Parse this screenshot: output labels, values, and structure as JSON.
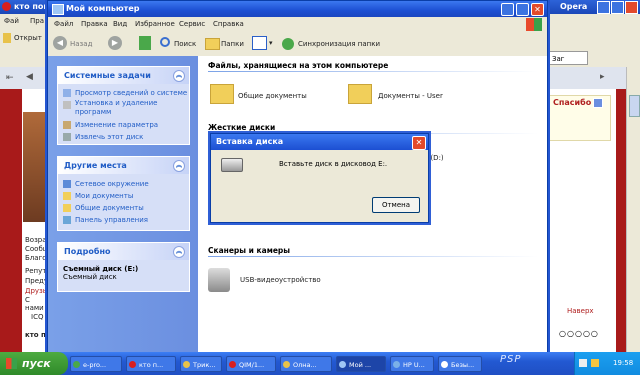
{
  "background_browser": {
    "tab_title": "кто пом",
    "browser_name": "Opera",
    "menu_prefix": "Фай",
    "menu_prefix2": "Пра",
    "toolbar_open": "Открыт",
    "right_tab": "Заг",
    "thanks": "Спасибо",
    "top_link": "Наверх",
    "bottom_label": "кто п",
    "left_texts": [
      "Возра",
      "Сообщ",
      "Благо",
      "Репут",
      "Преду",
      "Друзь",
      "С нами",
      "ICQ"
    ]
  },
  "window": {
    "title": "Мой компьютер",
    "menu": [
      "Файл",
      "Правка",
      "Вид",
      "Избранное",
      "Сервис",
      "Справка"
    ],
    "toolbar": {
      "back": "Назад",
      "search": "Поиск",
      "folders": "Папки",
      "sync": "Синхронизация папки"
    }
  },
  "left_panel": {
    "system_tasks": {
      "title": "Системные задачи",
      "items": [
        "Просмотр сведений о системе",
        "Установка и удаление программ",
        "Изменение параметра",
        "Извлечь этот диск"
      ]
    },
    "other_places": {
      "title": "Другие места",
      "items": [
        "Сетевое окружение",
        "Мои документы",
        "Общие документы",
        "Панель управления"
      ]
    },
    "details": {
      "title": "Подробно",
      "name": "Съемный диск (E:)",
      "type": "Съемный диск"
    }
  },
  "content": {
    "section_files": "Файлы, хранящиеся на этом компьютере",
    "shared_docs": "Общие документы",
    "user_docs": "Документы - User",
    "section_hdd": "Жесткие диски",
    "drive_d_suffix": "к (D:)",
    "section_scanners": "Сканеры и камеры",
    "usb_video": "USB-видеоустройство"
  },
  "dialog": {
    "title": "Вставка диска",
    "message": "Вставьте диск в дисковод E:.",
    "cancel": "Отмена"
  },
  "taskbar": {
    "start": "пуск",
    "tasks": [
      "e-pro...",
      "кто п...",
      "Трик...",
      "QIM/1...",
      "Олна...",
      "Мой ...",
      "HP U...",
      "Безы..."
    ],
    "clock": "19:58"
  },
  "colors": {
    "xp_blue": "#1c4fd2",
    "panel_link": "#215dc6",
    "dialog_close": "#e24a2b",
    "start_green": "#2f8a2a"
  }
}
